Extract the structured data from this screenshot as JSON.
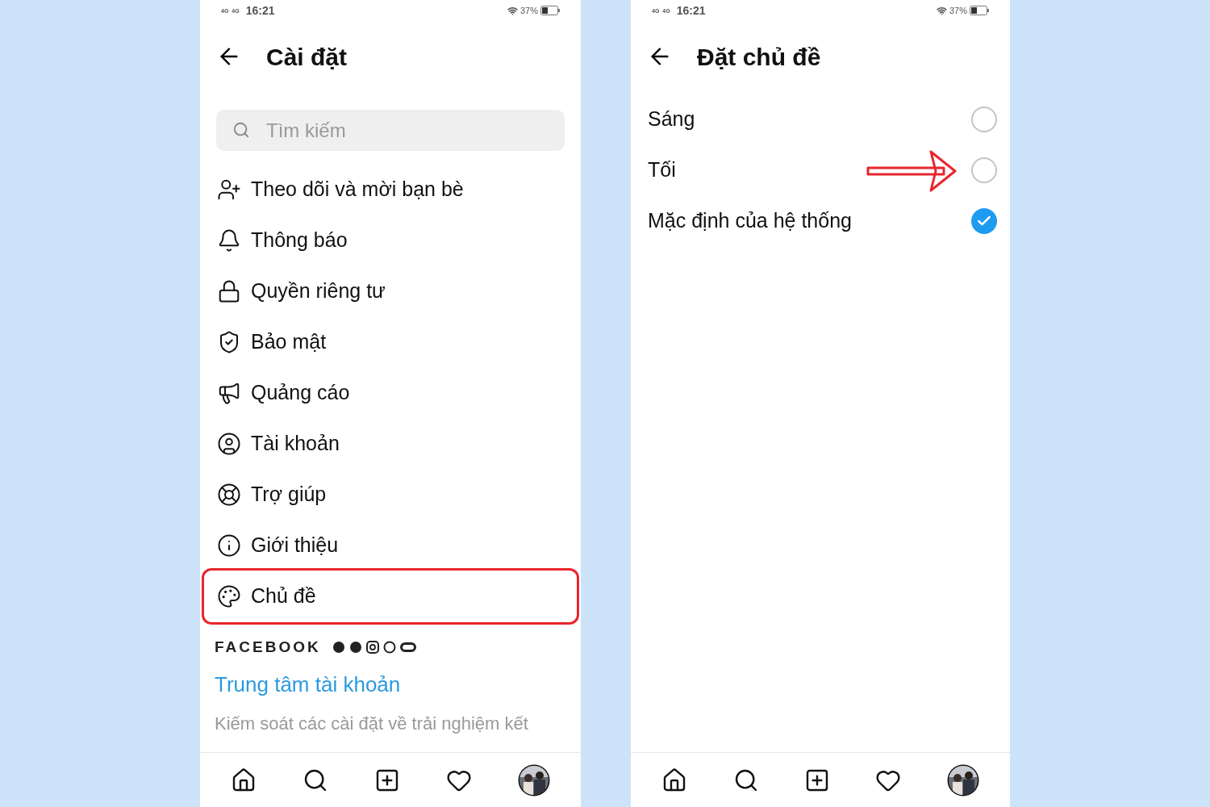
{
  "screens": [
    {
      "status_bar": {
        "signals": [
          "4G",
          "4G"
        ],
        "time": "16:21",
        "battery": "37%"
      },
      "title": "Cài đặt",
      "search": {
        "placeholder": "Tìm kiếm"
      },
      "items": [
        {
          "label": "Theo dõi và mời bạn bè",
          "highlighted": false
        },
        {
          "label": "Thông báo",
          "highlighted": false
        },
        {
          "label": "Quyền riêng tư",
          "highlighted": false
        },
        {
          "label": "Bảo mật",
          "highlighted": false
        },
        {
          "label": "Quảng cáo",
          "highlighted": false
        },
        {
          "label": "Tài khoản",
          "highlighted": false
        },
        {
          "label": "Trợ giúp",
          "highlighted": false
        },
        {
          "label": "Giới thiệu",
          "highlighted": false
        },
        {
          "label": "Chủ đề",
          "highlighted": true
        }
      ],
      "facebook": {
        "heading": "FACEBOOK",
        "link": "Trung tâm tài khoản",
        "description": "Kiếm soát các cài đặt về trải nghiệm kết"
      }
    },
    {
      "status_bar": {
        "signals": [
          "4G",
          "4G"
        ],
        "time": "16:21",
        "battery": "37%"
      },
      "title": "Đặt chủ đề",
      "options": [
        {
          "label": "Sáng",
          "selected": false,
          "arrow": false
        },
        {
          "label": "Tối",
          "selected": false,
          "arrow": true
        },
        {
          "label": "Mặc định của hệ thống",
          "selected": true,
          "arrow": false
        }
      ]
    }
  ]
}
